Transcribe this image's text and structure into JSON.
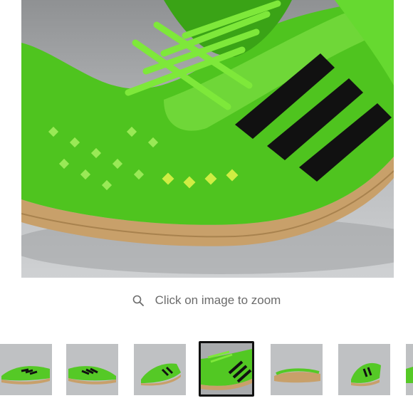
{
  "product": {
    "image_alt": "Green adidas indoor soccer shoe with black three stripes and gum sole",
    "zoom_hint": "Click on image to zoom",
    "zoom_icon": "search-icon"
  },
  "thumbnails": {
    "count_visible": 7,
    "selected_index": 3,
    "items": [
      {
        "view": "side-left"
      },
      {
        "view": "side-right"
      },
      {
        "view": "front-angle"
      },
      {
        "view": "closeup-laces"
      },
      {
        "view": "sole-bottom"
      },
      {
        "view": "heel-angle"
      },
      {
        "view": "partial"
      }
    ]
  },
  "colors": {
    "shoe_green": "#5fd12a",
    "stripe_black": "#111111",
    "sole_gum": "#c8a06a",
    "selected_border": "#111111",
    "hint_text": "#6b6b6b"
  }
}
